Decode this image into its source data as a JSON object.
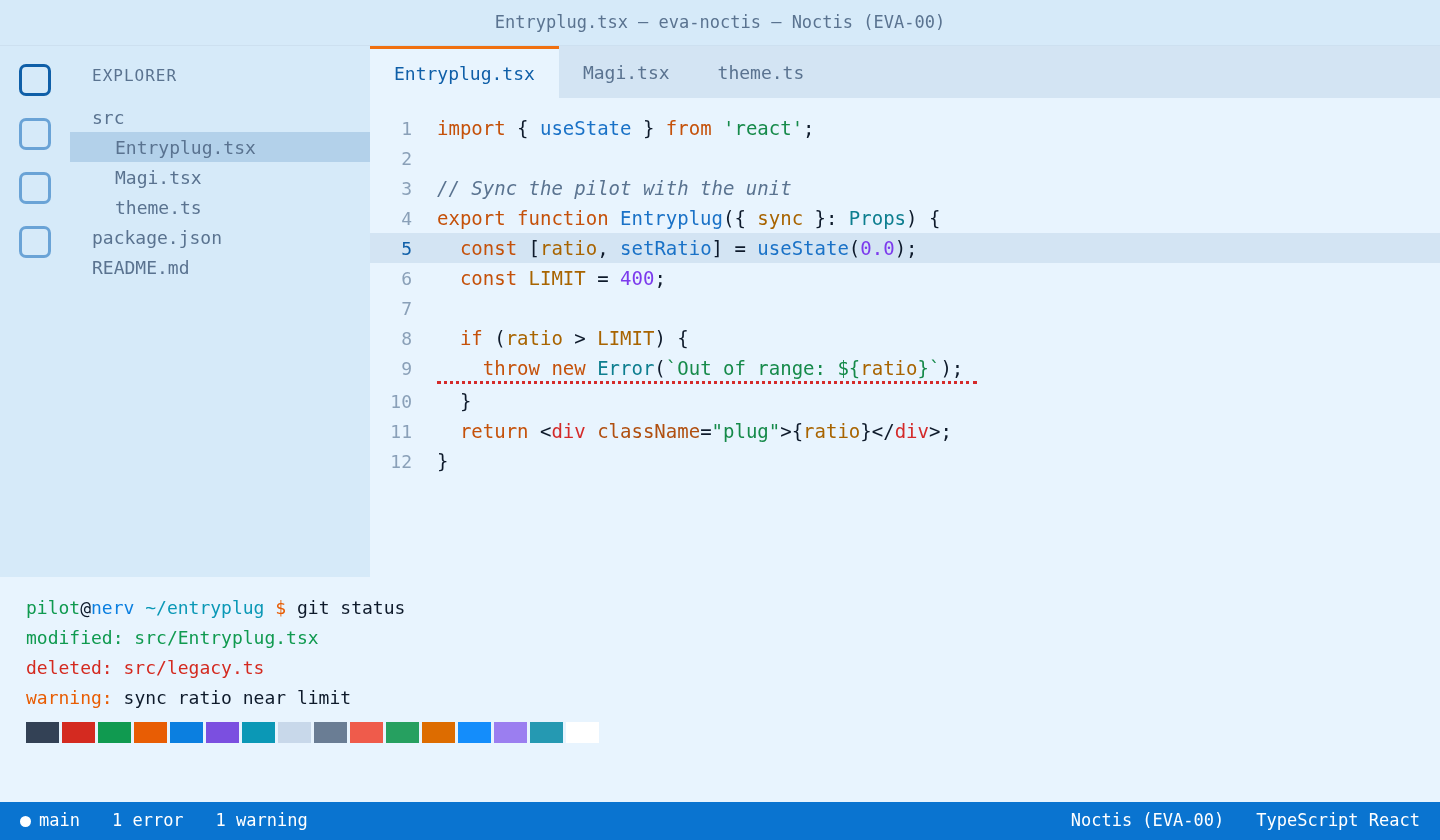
{
  "window": {
    "title": "Entryplug.tsx — eva-noctis — Noctis (EVA-00)"
  },
  "activity_bar": [
    {
      "selected": true
    },
    {
      "selected": false
    },
    {
      "selected": false
    },
    {
      "selected": false
    }
  ],
  "sidebar": {
    "title": "EXPLORER",
    "items": [
      {
        "label": "src",
        "selected": false,
        "children": [
          {
            "label": "Entryplug.tsx",
            "selected": true
          },
          {
            "label": "Magi.tsx",
            "selected": false
          },
          {
            "label": "theme.ts",
            "selected": false
          }
        ]
      },
      {
        "label": "package.json",
        "selected": false
      },
      {
        "label": "README.md",
        "selected": false
      }
    ]
  },
  "tabs": [
    {
      "label": "Entryplug.tsx",
      "selected": true
    },
    {
      "label": "Magi.tsx",
      "selected": false
    },
    {
      "label": "theme.ts",
      "selected": false
    }
  ],
  "editor": {
    "lines": [
      {
        "number": "1",
        "current": false,
        "error": false,
        "tokens": [
          {
            "kind": "keyword",
            "text": "import"
          },
          {
            "kind": "punct",
            "text": " { "
          },
          {
            "kind": "function",
            "text": "useState"
          },
          {
            "kind": "punct",
            "text": " } "
          },
          {
            "kind": "keyword",
            "text": "from"
          },
          {
            "kind": "string",
            "text": " 'react'"
          },
          {
            "kind": "punct",
            "text": ";"
          }
        ]
      },
      {
        "number": "2",
        "current": false,
        "error": false
      },
      {
        "number": "3",
        "current": false,
        "error": false,
        "tokens": [
          {
            "kind": "comment",
            "text": "// Sync the pilot with the unit"
          }
        ]
      },
      {
        "number": "4",
        "current": false,
        "error": false,
        "tokens": [
          {
            "kind": "keyword",
            "text": "export function"
          },
          {
            "kind": "function",
            "text": " Entryplug"
          },
          {
            "kind": "punct",
            "text": "({ "
          },
          {
            "kind": "variable",
            "text": "sync"
          },
          {
            "kind": "punct",
            "text": " }: "
          },
          {
            "kind": "type",
            "text": "Props"
          },
          {
            "kind": "punct",
            "text": ") {"
          }
        ]
      },
      {
        "number": "5",
        "current": true,
        "error": false,
        "tokens": [
          {
            "kind": "keyword",
            "text": "  const"
          },
          {
            "kind": "punct",
            "text": " ["
          },
          {
            "kind": "variable",
            "text": "ratio"
          },
          {
            "kind": "punct",
            "text": ", "
          },
          {
            "kind": "function",
            "text": "setRatio"
          },
          {
            "kind": "punct",
            "text": "] = "
          },
          {
            "kind": "function",
            "text": "useState"
          },
          {
            "kind": "punct",
            "text": "("
          },
          {
            "kind": "number",
            "text": "0.0"
          },
          {
            "kind": "punct",
            "text": ");"
          }
        ]
      },
      {
        "number": "6",
        "current": false,
        "error": false,
        "tokens": [
          {
            "kind": "keyword",
            "text": "  const"
          },
          {
            "kind": "variable",
            "text": " LIMIT"
          },
          {
            "kind": "punct",
            "text": " = "
          },
          {
            "kind": "number",
            "text": "400"
          },
          {
            "kind": "punct",
            "text": ";"
          }
        ]
      },
      {
        "number": "7",
        "current": false,
        "error": false
      },
      {
        "number": "8",
        "current": false,
        "error": false,
        "tokens": [
          {
            "kind": "keyword",
            "text": "  if"
          },
          {
            "kind": "punct",
            "text": " ("
          },
          {
            "kind": "variable",
            "text": "ratio"
          },
          {
            "kind": "punct",
            "text": " > "
          },
          {
            "kind": "variable",
            "text": "LIMIT"
          },
          {
            "kind": "punct",
            "text": ") {"
          }
        ]
      },
      {
        "number": "9",
        "current": false,
        "error": true,
        "tokens": [
          {
            "kind": "keyword",
            "text": "    throw new"
          },
          {
            "kind": "type",
            "text": " Error"
          },
          {
            "kind": "punct",
            "text": "("
          },
          {
            "kind": "string",
            "text": "`Out of range: ${"
          },
          {
            "kind": "variable",
            "text": "ratio"
          },
          {
            "kind": "string",
            "text": "}`"
          },
          {
            "kind": "punct",
            "text": ");"
          }
        ]
      },
      {
        "number": "10",
        "current": false,
        "error": false,
        "tokens": [
          {
            "kind": "punct",
            "text": "  }"
          }
        ]
      },
      {
        "number": "11",
        "current": false,
        "error": false,
        "tokens": [
          {
            "kind": "keyword",
            "text": "  return"
          },
          {
            "kind": "punct",
            "text": " <"
          },
          {
            "kind": "tag",
            "text": "div"
          },
          {
            "kind": "attribute",
            "text": " className"
          },
          {
            "kind": "punct",
            "text": "="
          },
          {
            "kind": "string",
            "text": "\"plug\""
          },
          {
            "kind": "punct",
            "text": ">{"
          },
          {
            "kind": "variable",
            "text": "ratio"
          },
          {
            "kind": "punct",
            "text": "}</"
          },
          {
            "kind": "tag",
            "text": "div"
          },
          {
            "kind": "punct",
            "text": ">;"
          }
        ]
      },
      {
        "number": "12",
        "current": false,
        "error": false,
        "tokens": [
          {
            "kind": "punct",
            "text": "}"
          }
        ]
      }
    ]
  },
  "terminal": {
    "lines": [
      [
        {
          "kind": "user",
          "text": "pilot"
        },
        {
          "kind": "plain",
          "text": "@"
        },
        {
          "kind": "host",
          "text": "nerv"
        },
        {
          "kind": "path",
          "text": " ~/entryplug"
        },
        {
          "kind": "prompt",
          "text": " $"
        },
        {
          "kind": "plain",
          "text": " git status"
        }
      ],
      [
        {
          "kind": "added",
          "text": "modified: src/Entryplug.tsx"
        }
      ],
      [
        {
          "kind": "deleted",
          "text": "deleted: src/legacy.ts"
        }
      ],
      [
        {
          "kind": "warning",
          "text": "warning:"
        },
        {
          "kind": "plain",
          "text": " sync ratio near limit"
        }
      ]
    ],
    "swatches": [
      {
        "color": "#334155"
      },
      {
        "color": "#d42a20"
      },
      {
        "color": "#109a50"
      },
      {
        "color": "#e85d04"
      },
      {
        "color": "#0b7fe0"
      },
      {
        "color": "#7b4fe0"
      },
      {
        "color": "#0b98b6"
      },
      {
        "color": "#c8d8ea"
      },
      {
        "color": "#6a7d94"
      },
      {
        "color": "#ef5b4b"
      },
      {
        "color": "#26a060"
      },
      {
        "color": "#dd6c00"
      },
      {
        "color": "#148dfb"
      },
      {
        "color": "#9b7ef0"
      },
      {
        "color": "#2599b2"
      },
      {
        "color": "#ffffff"
      }
    ]
  },
  "status_bar": {
    "left": [
      "main",
      "1 error",
      "1 warning"
    ],
    "right": [
      "Noctis (EVA-00)",
      "TypeScript React"
    ]
  }
}
